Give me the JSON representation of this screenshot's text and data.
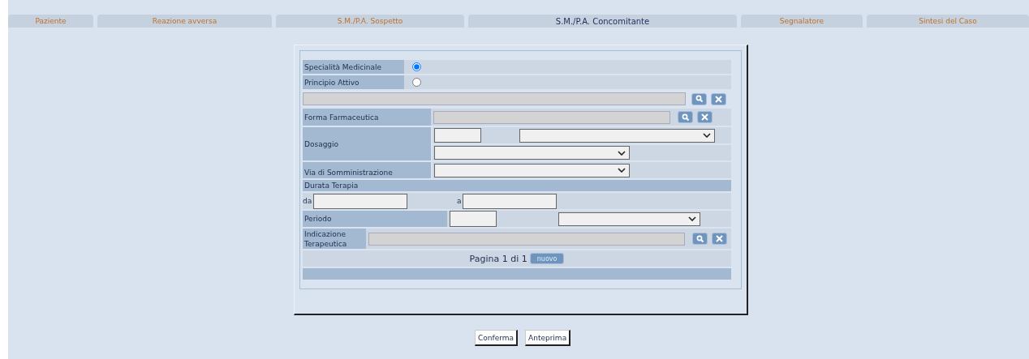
{
  "tabs": [
    {
      "label": "Paziente",
      "selected": false
    },
    {
      "label": "Reazione avversa",
      "selected": false
    },
    {
      "label": "S.M./P.A. Sospetto",
      "selected": false
    },
    {
      "label": "S.M./P.A. Concomitante",
      "selected": true
    },
    {
      "label": "Segnalatore",
      "selected": false
    },
    {
      "label": "Sintesi del Caso",
      "selected": false
    }
  ],
  "product_type": [
    {
      "label": "Specialità Medicinale",
      "selected": true
    },
    {
      "label": "Principio Attivo",
      "selected": false
    }
  ],
  "forma_label": "Forma Farmaceutica",
  "dosaggio_label": "Dosaggio",
  "via_label": "Via di Somministrazione",
  "durata": {
    "title": "Durata Terapia",
    "from_label": "da",
    "to_label": "a"
  },
  "periodo_label": "Periodo",
  "indicazione_label": "Indicazione Terapeutica",
  "pager": {
    "text": "Pagina 1 di 1",
    "new_button": "nuovo"
  },
  "buttons": [
    "Conferma",
    "Anteprima"
  ]
}
